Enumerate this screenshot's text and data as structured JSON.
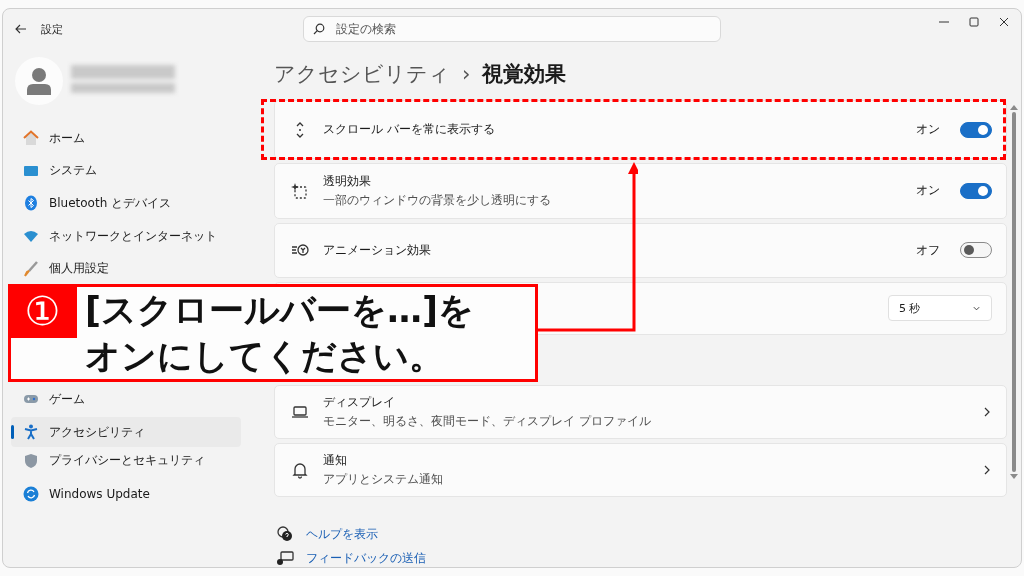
{
  "window": {
    "title": "設定"
  },
  "search": {
    "placeholder": "設定の検索"
  },
  "sidebar": {
    "items": [
      {
        "label": "ホーム",
        "selected": false
      },
      {
        "label": "システム",
        "selected": false
      },
      {
        "label": "Bluetooth とデバイス",
        "selected": false
      },
      {
        "label": "ネットワークとインターネット",
        "selected": false
      },
      {
        "label": "個人用設定",
        "selected": false
      },
      {
        "label": "ゲーム",
        "selected": false
      },
      {
        "label": "アクセシビリティ",
        "selected": true
      },
      {
        "label": "プライバシーとセキュリティ",
        "selected": false
      },
      {
        "label": "Windows Update",
        "selected": false
      }
    ]
  },
  "breadcrumb": {
    "parent": "アクセシビリティ",
    "separator": "›",
    "current": "視覚効果"
  },
  "settings": [
    {
      "kind": "toggle",
      "title": "スクロール バーを常に表示する",
      "state_label": "オン",
      "on": true
    },
    {
      "kind": "toggle",
      "title": "透明効果",
      "description": "一部のウィンドウの背景を少し透明にする",
      "state_label": "オン",
      "on": true
    },
    {
      "kind": "toggle",
      "title": "アニメーション効果",
      "state_label": "オフ",
      "on": false
    },
    {
      "kind": "dropdown",
      "value": "5 秒"
    }
  ],
  "related": [
    {
      "title": "ディスプレイ",
      "description": "モニター、明るさ、夜間モード、ディスプレイ プロファイル"
    },
    {
      "title": "通知",
      "description": "アプリとシステム通知"
    }
  ],
  "links": [
    "ヘルプを表示",
    "フィードバックの送信"
  ],
  "callout": {
    "number": "①",
    "lines": [
      "[スクロールバーを…]を",
      "オンにしてください。"
    ]
  }
}
